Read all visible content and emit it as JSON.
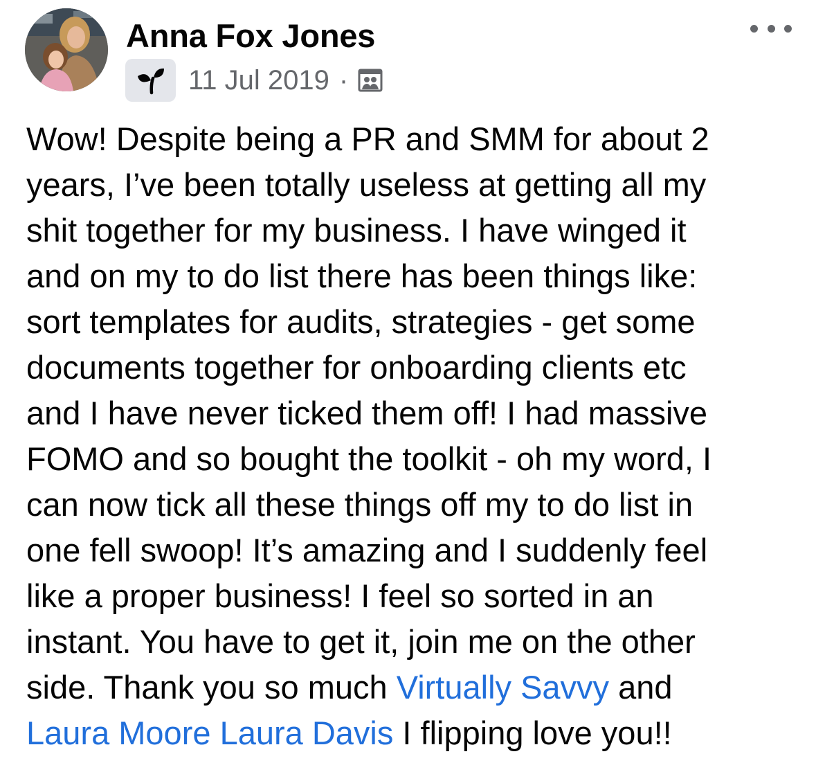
{
  "post": {
    "author": "Anna Fox Jones",
    "date": "11 Jul 2019",
    "separator": "·",
    "icons": {
      "badge": "group-member-sprout-icon",
      "audience": "group-audience-icon",
      "menu": "more-options-icon"
    },
    "body": {
      "lines": [
        "Wow! Despite being a PR and SMM for about 2",
        "years, I’ve been totally useless at getting all my",
        "shit together for my business. I have winged it",
        "and on my to do list there has been things like:",
        "sort templates for audits, strategies - get some",
        "documents together for onboarding clients etc",
        "and I have never ticked them off! I had massive",
        "FOMO and so bought the toolkit - oh my word, I",
        "can now tick all these things off my to do list in",
        "one fell swoop! It’s amazing and I suddenly feel",
        "like a proper business! I feel so sorted in an",
        "instant. You have to get it, join me on the other"
      ],
      "line13_prefix": "side. Thank you so much ",
      "mention_1": "Virtually Savvy",
      "line13_suffix": " and",
      "mention_2": "Laura Moore",
      "line14_space": " ",
      "mention_3": "Laura Davis",
      "line14_suffix": " I flipping love you!!"
    }
  },
  "colors": {
    "text": "#050505",
    "secondary": "#65676b",
    "link": "#216fdb",
    "badge_bg": "#e4e6eb"
  }
}
